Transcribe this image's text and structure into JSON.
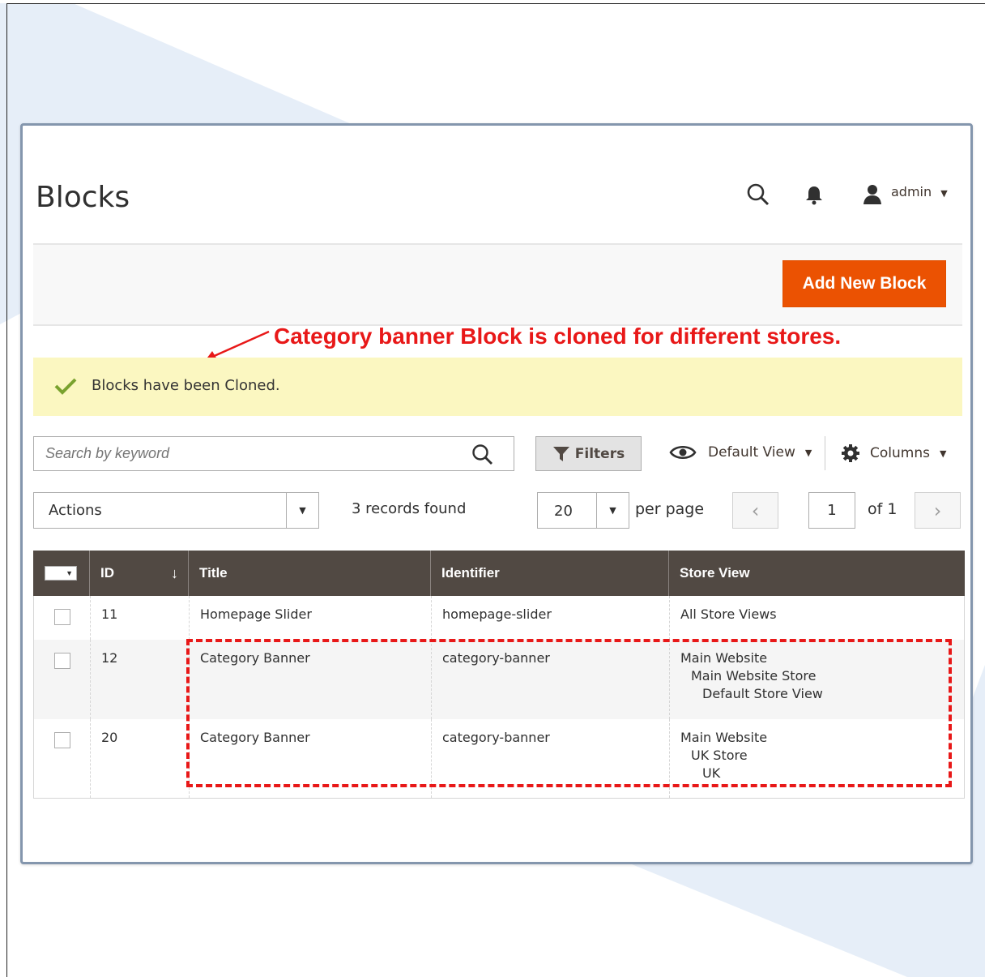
{
  "page": {
    "title": "Blocks"
  },
  "header": {
    "user_label": "admin"
  },
  "toolbar": {
    "add_button_label": "Add New Block"
  },
  "annotation": {
    "text": "Category banner Block is cloned for different stores."
  },
  "message": {
    "text": "Blocks have been Cloned."
  },
  "search": {
    "placeholder": "Search by keyword"
  },
  "controls": {
    "filters_label": "Filters",
    "view_label": "Default View",
    "columns_label": "Columns",
    "actions_label": "Actions",
    "records_found": "3 records found",
    "per_page_value": "20",
    "per_page_label": "per page",
    "page_current": "1",
    "page_of": "of 1"
  },
  "grid": {
    "columns": [
      "ID",
      "Title",
      "Identifier",
      "Store View"
    ],
    "rows": [
      {
        "id": "11",
        "title": "Homepage Slider",
        "identifier": "homepage-slider",
        "store": [
          "All Store Views"
        ]
      },
      {
        "id": "12",
        "title": "Category Banner",
        "identifier": "category-banner",
        "store": [
          "Main Website",
          "Main Website Store",
          "Default Store View"
        ]
      },
      {
        "id": "20",
        "title": "Category Banner",
        "identifier": "category-banner",
        "store": [
          "Main Website",
          "UK Store",
          "UK"
        ]
      }
    ]
  },
  "colors": {
    "accent": "#eb5202",
    "grid_header": "#514943",
    "message_bg": "#fbf7c1",
    "annotation": "#e81818",
    "frame_border": "#8496ad"
  }
}
